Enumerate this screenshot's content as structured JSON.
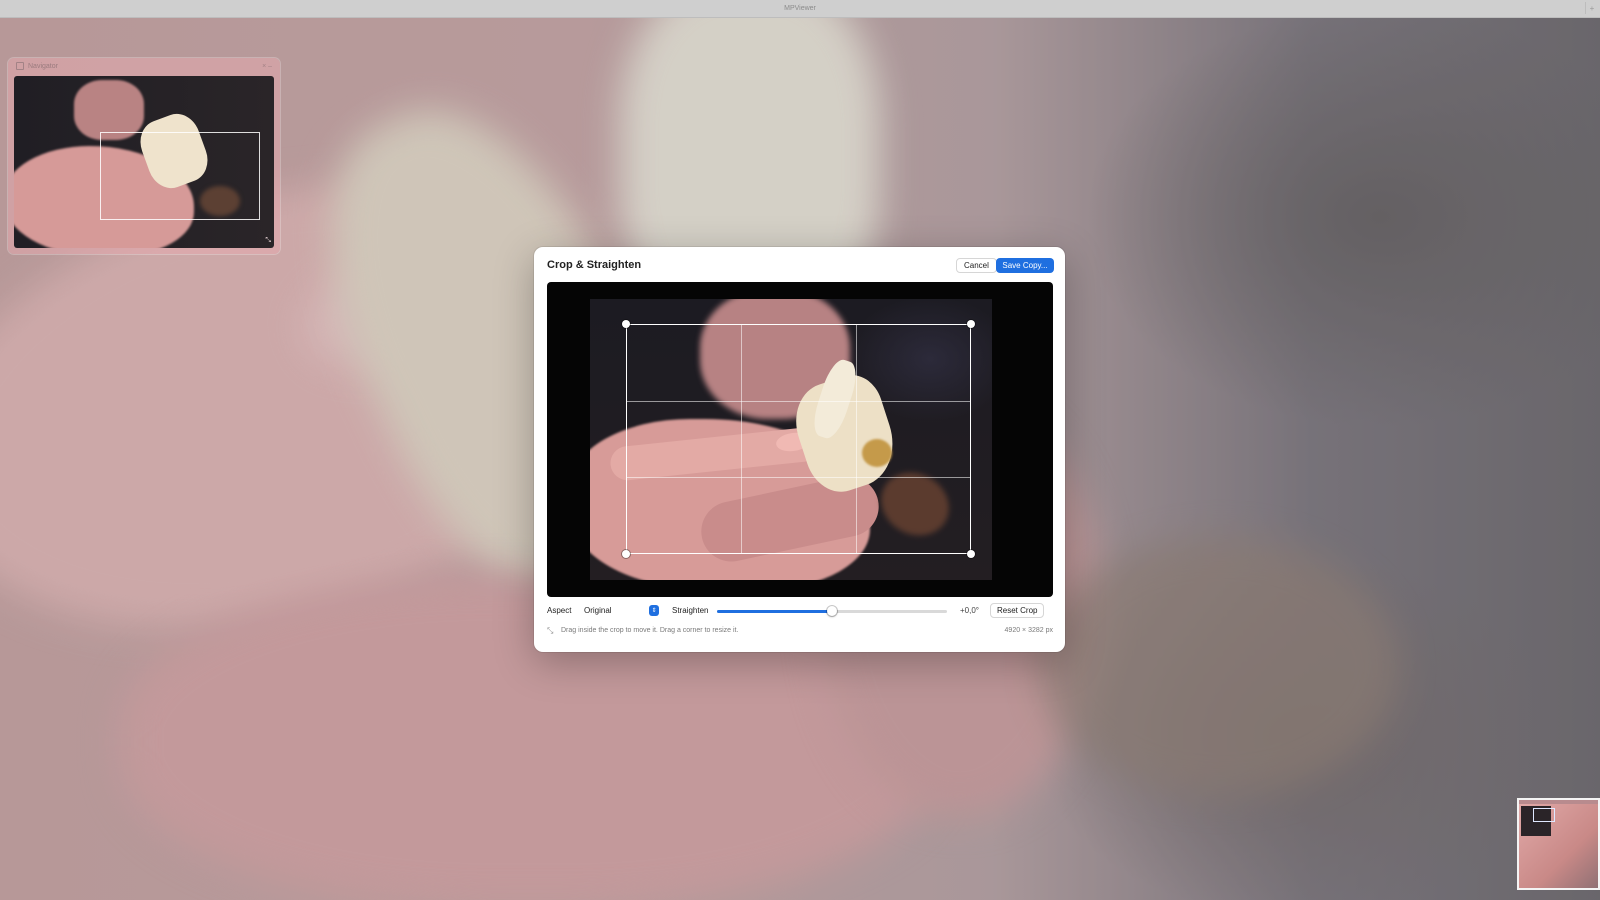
{
  "window": {
    "title": "MPViewer"
  },
  "navigator": {
    "title": "Navigator"
  },
  "dialog": {
    "title": "Crop & Straighten",
    "cancel_label": "Cancel",
    "save_label": "Save Copy...",
    "aspect_label": "Aspect",
    "aspect_value": "Original",
    "straighten_label": "Straighten",
    "straighten_value_fraction": 0.5,
    "angle_text": "+0,0°",
    "reset_label": "Reset Crop",
    "hint": "Drag inside the crop to move it. Drag a corner to resize it.",
    "dimensions": "4920 × 3282 px"
  },
  "colors": {
    "accent": "#1f6fe0",
    "dialog_bg": "#ffffff",
    "canvas_bg": "#050505"
  },
  "icons": {
    "fullscreen": "expand-icon",
    "select_arrows": "up-down-chevron-icon",
    "hint": "resize-arrows-icon"
  }
}
